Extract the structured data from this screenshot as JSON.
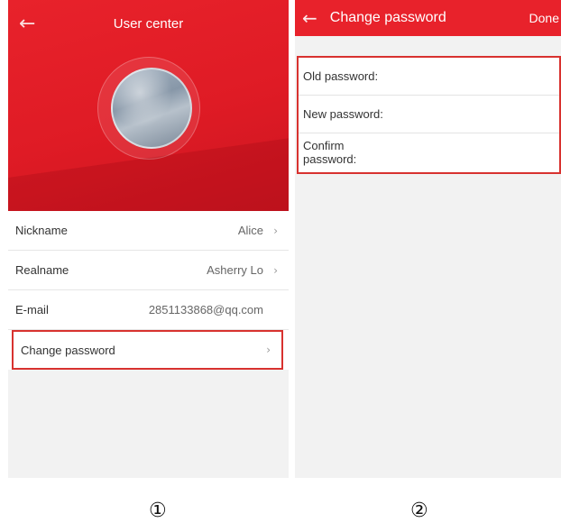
{
  "screen1": {
    "title": "User center",
    "back_icon": "←",
    "rows": [
      {
        "label": "Nickname",
        "value": "Alice",
        "chevron": "›"
      },
      {
        "label": "Realname",
        "value": "Asherry Lo",
        "chevron": "›"
      },
      {
        "label": "E-mail",
        "value": "2851133868@qq.com",
        "chevron": ""
      },
      {
        "label": "Change password",
        "value": "",
        "chevron": "›"
      }
    ]
  },
  "screen2": {
    "title": "Change password",
    "back_icon": "←",
    "done_label": "Done",
    "fields": [
      {
        "label": "Old password:",
        "value": ""
      },
      {
        "label": "New password:",
        "value": ""
      },
      {
        "label": "Confirm password:",
        "value": ""
      }
    ]
  },
  "captions": [
    "①",
    "②"
  ],
  "colors": {
    "accent": "#e8222b",
    "highlight_border": "#d8322f",
    "background": "#f2f2f2"
  }
}
